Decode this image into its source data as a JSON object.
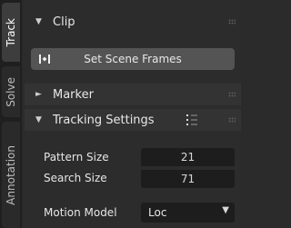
{
  "tabs": [
    {
      "label": "Track",
      "active": true
    },
    {
      "label": "Solve",
      "active": false
    },
    {
      "label": "Annotation",
      "active": false
    }
  ],
  "clip": {
    "title": "Clip",
    "expanded": true,
    "set_scene_frames_label": "Set Scene Frames",
    "button_icon": "clip-frames-icon"
  },
  "marker": {
    "title": "Marker",
    "expanded": false
  },
  "tracking_settings": {
    "title": "Tracking Settings",
    "expanded": true,
    "presets_icon": "preset-list-icon",
    "pattern_size_label": "Pattern Size",
    "pattern_size_value": "21",
    "search_size_label": "Search Size",
    "search_size_value": "71",
    "motion_model_label": "Motion Model",
    "motion_model_value": "Loc"
  },
  "colors": {
    "tab_active": "#3d3d3d",
    "tab_inactive": "#2a2a2a",
    "panel_bg": "#2c2c2c",
    "field_bg": "#1d1d1d",
    "button_bg": "#545454"
  }
}
